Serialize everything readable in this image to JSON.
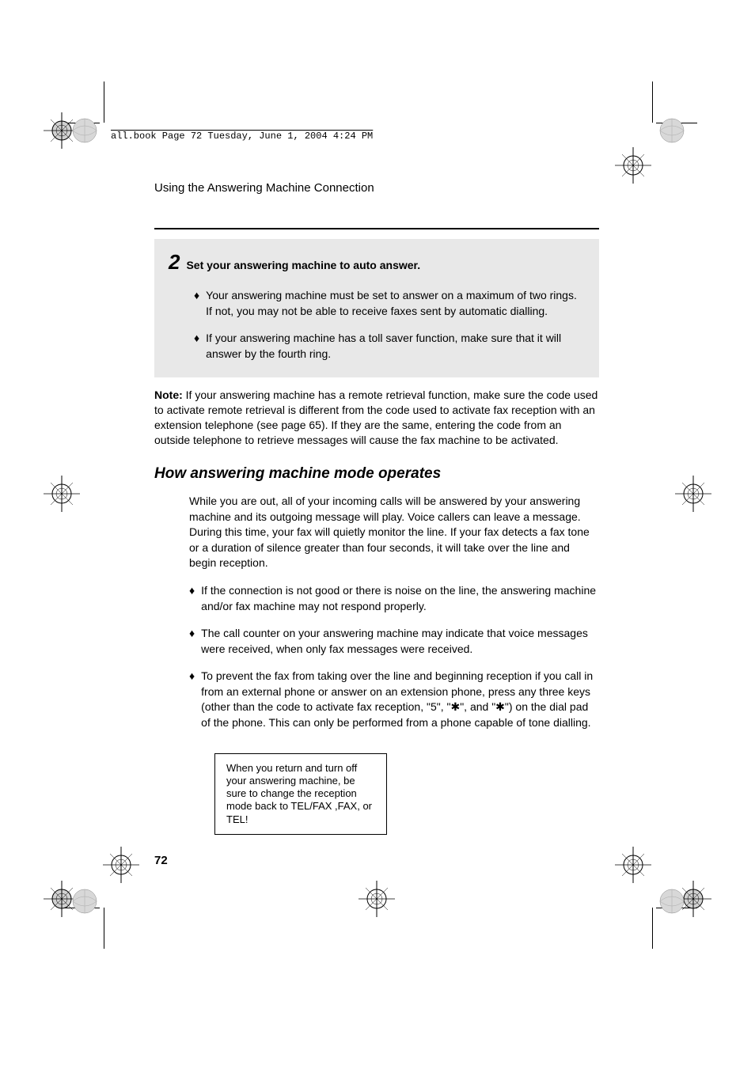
{
  "header": {
    "file_info": "all.book  Page 72  Tuesday, June 1, 2004  4:24 PM",
    "section_title": "Using the Answering Machine Connection"
  },
  "step": {
    "number": "2",
    "title": "Set your answering machine to auto answer.",
    "bullets": [
      "Your answering machine must be set to answer on a maximum of two rings. If not, you may not be able to receive faxes sent by automatic dialling.",
      "If your answering machine has a toll saver function, make sure that it will answer by the fourth ring."
    ]
  },
  "note": {
    "label": "Note:",
    "text": " If your answering machine has a remote retrieval function, make sure the code used to activate remote retrieval is different from the code used to activate fax reception with an extension telephone (see page 65). If they are the same, entering the code from an outside telephone to retrieve messages will cause the fax machine to be activated."
  },
  "section": {
    "heading": "How answering machine mode operates",
    "intro": "While you are out, all of your incoming calls will be answered by your answering machine and its outgoing message will play. Voice callers can leave a message. During this time, your fax will quietly monitor the line. If your fax detects a fax tone or a duration of silence greater than four seconds, it will take over the line and begin reception.",
    "bullets": [
      "If the connection is not good or there is noise on the line, the answering machine and/or fax machine may not respond properly.",
      "The call counter on your answering machine may indicate that voice messages were received, when only fax messages were received.",
      "To prevent the fax from taking over the line and beginning reception if you call in from an external phone or answer on an extension phone, press any three keys (other than the code to activate fax reception, \"5\", \"✱\", and \"✱\") on the dial pad of the phone. This can only be performed from a phone capable of tone dialling."
    ]
  },
  "callout": "When you return and turn off your answering machine, be sure to change the reception mode back to TEL/FAX ,FAX, or TEL!",
  "page_number": "72",
  "bullet_char": "♦"
}
